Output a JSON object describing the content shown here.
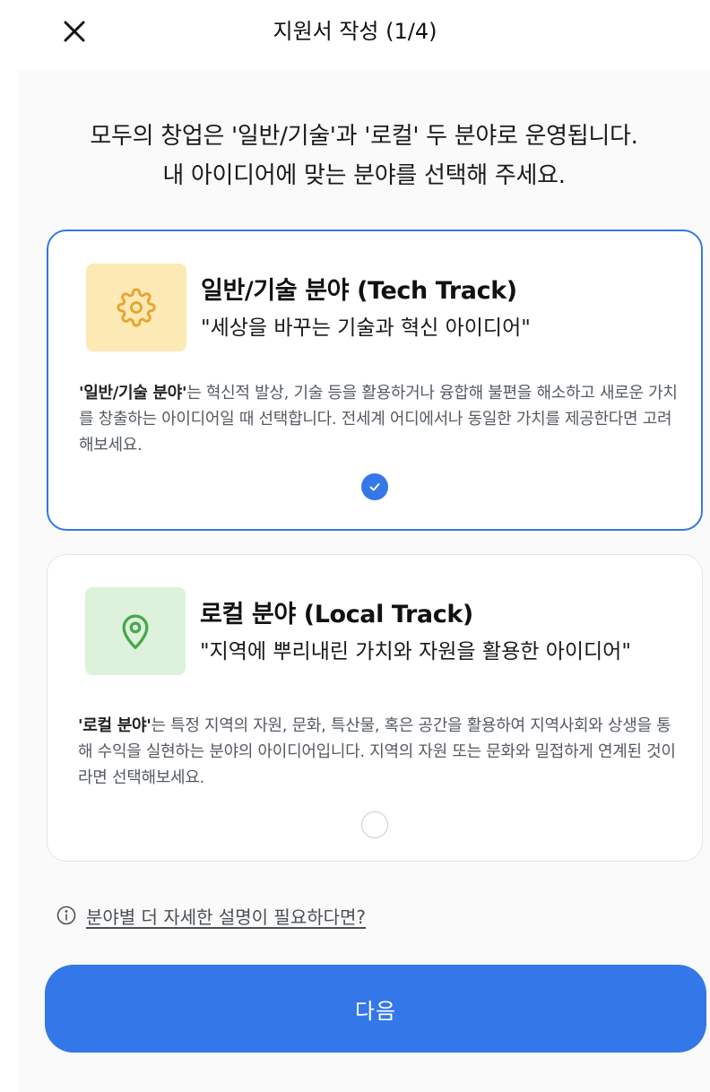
{
  "header": {
    "title": "지원서 작성 (1/4)",
    "close_icon": "close-icon"
  },
  "intro": {
    "line1": "모두의 창업은 '일반/기술'과 '로컬' 두 분야로 운영됩니다.",
    "line2": "내 아이디어에 맞는 분야를 선택해 주세요."
  },
  "tracks": [
    {
      "icon": "gear-icon",
      "icon_bg": "#fde9b4",
      "icon_color": "#e8a431",
      "title": "일반/기술 분야 (Tech Track)",
      "subtitle": "\"세상을 바꾸는 기술과 혁신 아이디어\"",
      "desc_bold": "'일반/기술 분야'",
      "desc_rest": "는 혁신적 발상, 기술 등을 활용하거나 융합해 불편을 해소하고 새로운 가치를 창출하는 아이디어일 때 선택합니다. 전세계 어디에서나 동일한 가치를 제공한다면 고려해보세요.",
      "selected": true
    },
    {
      "icon": "location-pin-icon",
      "icon_bg": "#ddf2da",
      "icon_color": "#4aa64f",
      "title": "로컬 분야 (Local Track)",
      "subtitle": "\"지역에 뿌리내린 가치와 자원을 활용한 아이디어\"",
      "desc_bold": "'로컬 분야'",
      "desc_rest": "는 특정 지역의 자원, 문화, 특산물, 혹은 공간을 활용하여 지역사회와 상생을 통해 수익을 실현하는 분야의 아이디어입니다. 지역의 자원 또는 문화와 밀접하게 연계된 것이라면 선택해보세요.",
      "selected": false
    }
  ],
  "help": {
    "icon": "info-icon",
    "label": "분야별 더 자세한 설명이 필요하다면?"
  },
  "next_button": {
    "label": "다음"
  },
  "colors": {
    "accent": "#3477e8",
    "content_bg": "#fafafa",
    "card_border": "#e2e4e8"
  }
}
